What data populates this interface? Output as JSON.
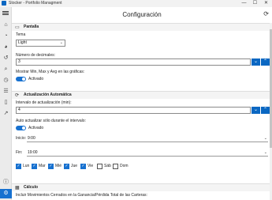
{
  "window": {
    "title": "Stocker - Portfolio Managment",
    "minimize_glyph": "—",
    "maximize_glyph": "☐",
    "close_glyph": "✕"
  },
  "sidebar": {
    "items": [
      {
        "icon": "home-icon",
        "glyph": "⌂"
      },
      {
        "icon": "chart-pie-icon",
        "glyph": "◔"
      },
      {
        "icon": "globe-icon",
        "glyph": "◕"
      },
      {
        "icon": "history-icon",
        "glyph": "↺"
      },
      {
        "icon": "search-icon",
        "glyph": "⌕"
      },
      {
        "icon": "clock-icon",
        "glyph": "◷"
      },
      {
        "icon": "list-icon",
        "glyph": "☰"
      },
      {
        "icon": "mobile-icon",
        "glyph": "▯"
      },
      {
        "icon": "trending-icon",
        "glyph": "↗"
      },
      {
        "icon": "help-icon",
        "glyph": "ⓘ"
      },
      {
        "icon": "settings-icon",
        "glyph": "⚙"
      }
    ]
  },
  "header": {
    "title": "Configuración",
    "refresh_glyph": "⟳"
  },
  "pantalla": {
    "section_title": "Pantalla",
    "tema_label": "Tema",
    "tema_value": "Light",
    "decimales_label": "Número de decimales:",
    "decimales_value": "3",
    "minmax_label": "Mostrar Min, Max y Avg en las gráficas:",
    "minmax_toggle": "Activado"
  },
  "actualizacion": {
    "section_title": "Actualización Automática",
    "intervalo_label": "Intervalo de actualización (min):",
    "intervalo_value": "4",
    "auto_label": "Auto actualizar sólo durante el intervalo:",
    "auto_toggle": "Activado",
    "inicio_label": "Inicio:",
    "inicio_value": "9:00",
    "fin_label": "Fin:",
    "fin_value": "19:00",
    "days": [
      {
        "label": "Lun",
        "checked": true
      },
      {
        "label": "Mar",
        "checked": true
      },
      {
        "label": "Mié",
        "checked": true
      },
      {
        "label": "Jue",
        "checked": true
      },
      {
        "label": "Vie",
        "checked": true
      },
      {
        "label": "Sáb",
        "checked": false
      },
      {
        "label": "Dom",
        "checked": false
      }
    ]
  },
  "calculo": {
    "section_title": "Cálculo",
    "movimientos_label": "Incluir Movimientos Cerrados en la Ganancia/Pérdida Total de las Carteras:"
  },
  "glyphs": {
    "chevron_down": "⌄",
    "arrow_down": "⌄",
    "arrow_up": "⌃",
    "check": "✓"
  },
  "colors": {
    "accent": "#1771d0",
    "sidebar_bg": "#ebebeb",
    "section_bg": "#f4f4f4"
  }
}
